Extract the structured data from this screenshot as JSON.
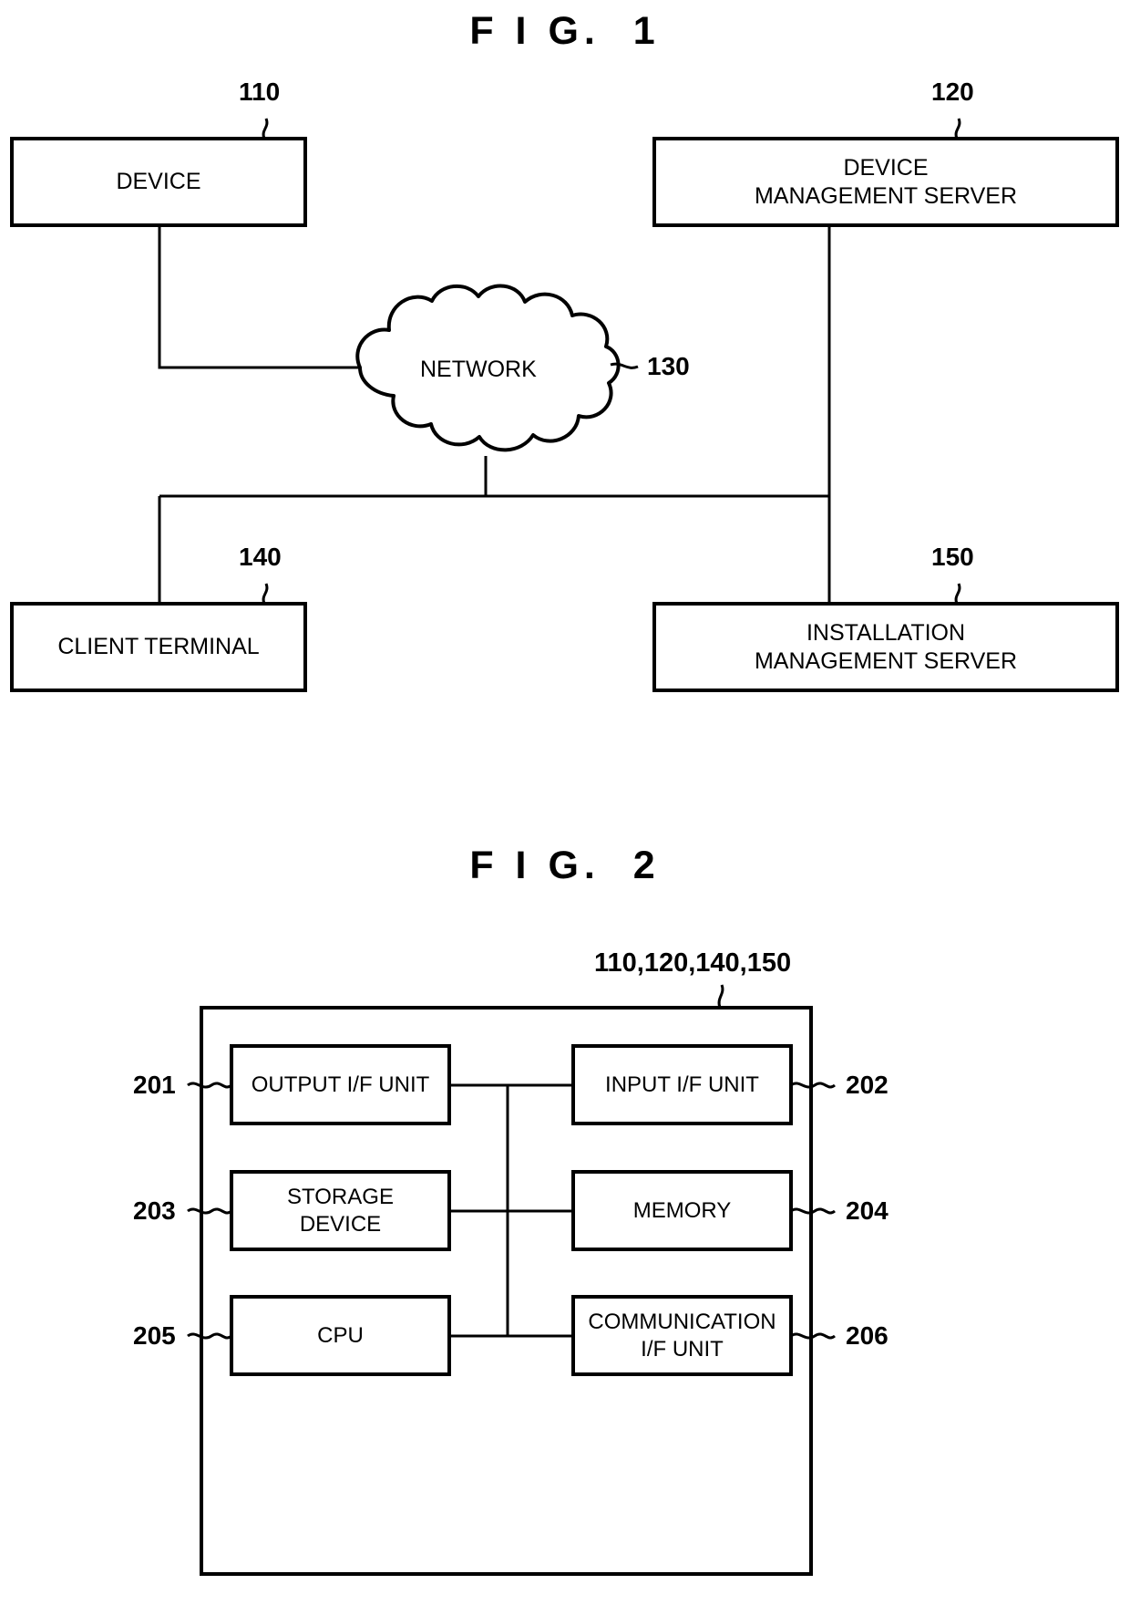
{
  "figures": [
    {
      "id": "fig1",
      "title": "F I G.  1",
      "nodes": [
        {
          "key": "device",
          "label": "DEVICE",
          "ref": "110"
        },
        {
          "key": "dev_server",
          "label": "DEVICE\nMANAGEMENT SERVER",
          "ref": "120"
        },
        {
          "key": "network",
          "label": "NETWORK",
          "ref": "130"
        },
        {
          "key": "client",
          "label": "CLIENT TERMINAL",
          "ref": "140"
        },
        {
          "key": "inst_server",
          "label": "INSTALLATION\nMANAGEMENT SERVER",
          "ref": "150"
        }
      ]
    },
    {
      "id": "fig2",
      "title": "F I G.  2",
      "outer_ref": "110,120,140,150",
      "units": [
        {
          "key": "output_if",
          "label": "OUTPUT I/F UNIT",
          "ref": "201"
        },
        {
          "key": "input_if",
          "label": "INPUT I/F UNIT",
          "ref": "202"
        },
        {
          "key": "storage",
          "label": "STORAGE\nDEVICE",
          "ref": "203"
        },
        {
          "key": "memory",
          "label": "MEMORY",
          "ref": "204"
        },
        {
          "key": "cpu",
          "label": "CPU",
          "ref": "205"
        },
        {
          "key": "comm_if",
          "label": "COMMUNICATION\nI/F UNIT",
          "ref": "206"
        }
      ]
    }
  ],
  "style": {
    "ink": "#000000",
    "paper": "#ffffff"
  }
}
